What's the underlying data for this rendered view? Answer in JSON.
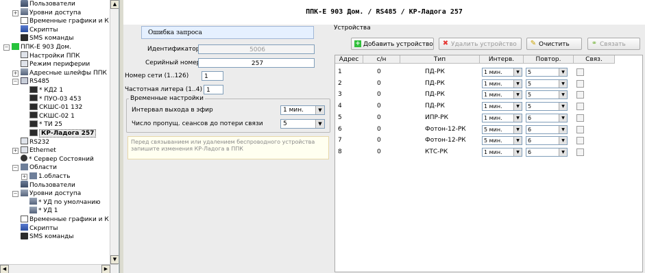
{
  "tree": [
    {
      "label": "Пользователи",
      "indent": 1
    },
    {
      "label": "Уровни доступа",
      "indent": 1,
      "expand": "+"
    },
    {
      "label": "Временные графики и К",
      "indent": 1
    },
    {
      "label": "Скрипты",
      "indent": 1
    },
    {
      "label": "SMS команды",
      "indent": 1
    },
    {
      "label": "ППК-Е 903 Дом.",
      "indent": 0,
      "expand": "-"
    },
    {
      "label": "Настройки ППК",
      "indent": 1
    },
    {
      "label": "Режим периферии",
      "indent": 1
    },
    {
      "label": "Адресные шлейфы ППК",
      "indent": 1,
      "expand": "+"
    },
    {
      "label": "RS485",
      "indent": 1,
      "expand": "-"
    },
    {
      "label": "* КД2 1",
      "indent": 2
    },
    {
      "label": "* ПУО-03 453",
      "indent": 2
    },
    {
      "label": "СКШС-01 132",
      "indent": 2
    },
    {
      "label": "СКШС-02 1",
      "indent": 2
    },
    {
      "label": "* ТИ 25",
      "indent": 2
    },
    {
      "label": "КР-Ладога 257",
      "indent": 2,
      "selected": true
    },
    {
      "label": "RS232",
      "indent": 1
    },
    {
      "label": "Ethernet",
      "indent": 1,
      "expand": "+"
    },
    {
      "label": "* Сервер Состояний",
      "indent": 1
    },
    {
      "label": "Области",
      "indent": 1,
      "expand": "-"
    },
    {
      "label": "1.область",
      "indent": 2,
      "expand": "+"
    },
    {
      "label": "Пользователи",
      "indent": 1
    },
    {
      "label": "Уровни доступа",
      "indent": 1,
      "expand": "-"
    },
    {
      "label": "* УД по умолчанию",
      "indent": 2
    },
    {
      "label": "* УД 1",
      "indent": 2
    },
    {
      "label": "Временные графики и К",
      "indent": 1
    },
    {
      "label": "Скрипты",
      "indent": 1
    },
    {
      "label": "SMS команды",
      "indent": 1
    }
  ],
  "title": "ППК-Е 903 Дом. / RS485 / КР-Ладога 257",
  "error_text": "Ошибка запроса",
  "identifier": {
    "label": "Идентификатор",
    "value": "5006"
  },
  "serial": {
    "label": "Серийный номер",
    "value": "257"
  },
  "net_number": {
    "label": "Номер сети (1..126)",
    "value": "1"
  },
  "freq_letter": {
    "label": "Частотная литера (1..4)",
    "value": "1"
  },
  "time_settings": {
    "group_title": "Временные настройки",
    "interval_label": "Интервал выхода в эфир",
    "interval_value": "1 мин.",
    "missed_label": "Число пропущ. сеансов до потери связи",
    "missed_value": "5"
  },
  "note": "Перед связыванием или удалением беспроводного устройства запишите изменения КР-Ладога в ППК",
  "devices": {
    "group_title": "Устройства",
    "buttons": {
      "add": "Добавить устройство",
      "remove": "Удалить устройство",
      "clear": "Очистить",
      "link": "Связать"
    },
    "columns": [
      "Адрес",
      "с/н",
      "Тип",
      "Интерв.",
      "Повтор.",
      "Связ."
    ],
    "rows": [
      {
        "addr": "1",
        "sn": "0",
        "type": "ПД-РК",
        "interval": "1 мин.",
        "repeat": "5"
      },
      {
        "addr": "2",
        "sn": "0",
        "type": "ПД-РК",
        "interval": "1 мин.",
        "repeat": "5"
      },
      {
        "addr": "3",
        "sn": "0",
        "type": "ПД-РК",
        "interval": "1 мин.",
        "repeat": "5"
      },
      {
        "addr": "4",
        "sn": "0",
        "type": "ПД-РК",
        "interval": "1 мин.",
        "repeat": "5"
      },
      {
        "addr": "5",
        "sn": "0",
        "type": "ИПР-РК",
        "interval": "1 мин.",
        "repeat": "6"
      },
      {
        "addr": "6",
        "sn": "0",
        "type": "Фотон-12-РК",
        "interval": "5 мин.",
        "repeat": "6"
      },
      {
        "addr": "7",
        "sn": "0",
        "type": "Фотон-12-РК",
        "interval": "5 мин.",
        "repeat": "6"
      },
      {
        "addr": "8",
        "sn": "0",
        "type": "КТС-РК",
        "interval": "1 мин.",
        "repeat": "6"
      }
    ]
  },
  "colors": {
    "green_status": "#27c33c",
    "accent_blue": "#e5f0ff"
  }
}
